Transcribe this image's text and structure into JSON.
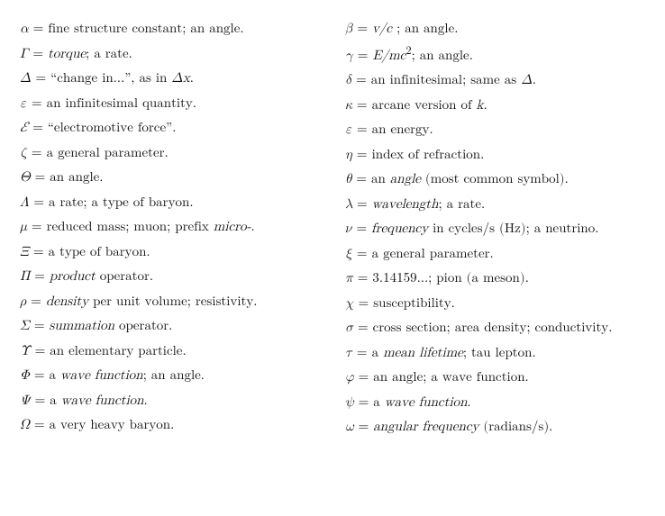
{
  "entries": [
    {
      "col": 0,
      "html": "<span class=\"math\">α</span> = fine structure constant; an angle."
    },
    {
      "col": 1,
      "html": "<span class=\"math\">β</span> = <em>v/c</em> ; an angle."
    },
    {
      "col": 0,
      "html": "<span class=\"math\">Γ</span> = <em>torque</em>; a rate."
    },
    {
      "col": 1,
      "html": "<span class=\"math\">γ</span> = <em>E/mc</em><sup>2</sup>; an angle."
    },
    {
      "col": 0,
      "html": "<span class=\"math\">Δ</span> = &#8220;change in...&#8221;, as in <span class=\"math\">Δx</span>."
    },
    {
      "col": 1,
      "html": "<span class=\"math\">δ</span> = an infinitesimal; same as <span class=\"math\">Δ</span>."
    },
    {
      "col": 0,
      "html": "<span class=\"math\">ε</span> = an infinitesimal quantity."
    },
    {
      "col": 1,
      "html": "<span class=\"math\">κ</span> = arcane version of <em>k</em>."
    },
    {
      "col": 0,
      "html": "<span class=\"math\">&#x2130;</span> = &#8220;electromotive force&#8221;."
    },
    {
      "col": 1,
      "html": "<span class=\"math\">ε</span> = an energy."
    },
    {
      "col": 0,
      "html": "<span class=\"math\">ζ</span> = a general parameter."
    },
    {
      "col": 1,
      "html": "<span class=\"math\">η</span> = index of refraction."
    },
    {
      "col": 0,
      "html": "<span class=\"math\">Θ</span> = an angle."
    },
    {
      "col": 1,
      "html": "<span class=\"math\">θ</span> = an <em>angle</em> (most common symbol)."
    },
    {
      "col": 0,
      "html": "<span class=\"math\">Λ</span> = a rate; a type of baryon."
    },
    {
      "col": 1,
      "html": "<span class=\"math\">λ</span> = <em>wavelength</em>; a rate."
    },
    {
      "col": 0,
      "html": "<span class=\"math\">μ</span> = reduced mass; muon; prefix <em>micro-</em>."
    },
    {
      "col": 1,
      "html": "<span class=\"math\">ν</span> = <em>frequency</em> in cycles/s (Hz); a neutrino."
    },
    {
      "col": 0,
      "html": "<span class=\"math\">Ξ</span> = a type of baryon."
    },
    {
      "col": 1,
      "html": "<span class=\"math\">ξ</span> = a general parameter."
    },
    {
      "col": 0,
      "html": "<span class=\"math\">Π</span> = <em>product</em> operator."
    },
    {
      "col": 1,
      "html": "<span class=\"math\">π</span> = 3.14159&#8230;; pion (a meson)."
    },
    {
      "col": 0,
      "html": "<span class=\"math\">ρ</span> = <em>density</em> per unit volume; resistivity."
    },
    {
      "col": 1,
      "html": "<span class=\"math\">χ</span> = susceptibility."
    },
    {
      "col": 0,
      "html": "<span class=\"math\">Σ</span> = <em>summation</em> operator."
    },
    {
      "col": 1,
      "html": "<span class=\"math\">σ</span> = cross section; area density; conductivity."
    },
    {
      "col": 0,
      "html": "<span class=\"math\">Υ</span> = an elementary particle."
    },
    {
      "col": 1,
      "html": "<span class=\"math\">τ</span> = a <em>mean lifetime</em>; tau lepton."
    },
    {
      "col": 0,
      "html": "<span class=\"math\">Φ</span> = a <em>wave function</em>; an angle."
    },
    {
      "col": 1,
      "html": "<span class=\"math\">φ</span> = an angle; a wave function."
    },
    {
      "col": 0,
      "html": "<span class=\"math\">Ψ</span> = a <em>wave function</em>."
    },
    {
      "col": 1,
      "html": "<span class=\"math\">ψ</span> = a <em>wave function</em>."
    },
    {
      "col": 0,
      "html": "<span class=\"math\">Ω</span> = a very heavy baryon."
    },
    {
      "col": 1,
      "html": "<span class=\"math\">ω</span> = <em>angular frequency</em> (radians/s)."
    }
  ]
}
